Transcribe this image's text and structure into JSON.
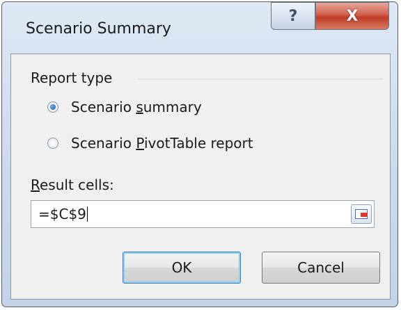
{
  "window": {
    "title": "Scenario Summary",
    "help_glyph": "?",
    "close_glyph": "X"
  },
  "report_type": {
    "label": "Report type",
    "options": [
      {
        "pre": "Scenario ",
        "accel": "s",
        "post": "ummary",
        "selected": true
      },
      {
        "pre": "Scenario ",
        "accel": "P",
        "post": "ivotTable report",
        "selected": false
      }
    ]
  },
  "result_cells": {
    "label_accel": "R",
    "label_rest": "esult cells:",
    "value": "=$C$9",
    "collapse_icon": "collapse-dialog-icon"
  },
  "buttons": {
    "ok": "OK",
    "cancel": "Cancel"
  },
  "colors": {
    "close_red": "#c03a26",
    "radio_blue": "#1d5fa8",
    "ok_focus": "#3c7fb1"
  }
}
